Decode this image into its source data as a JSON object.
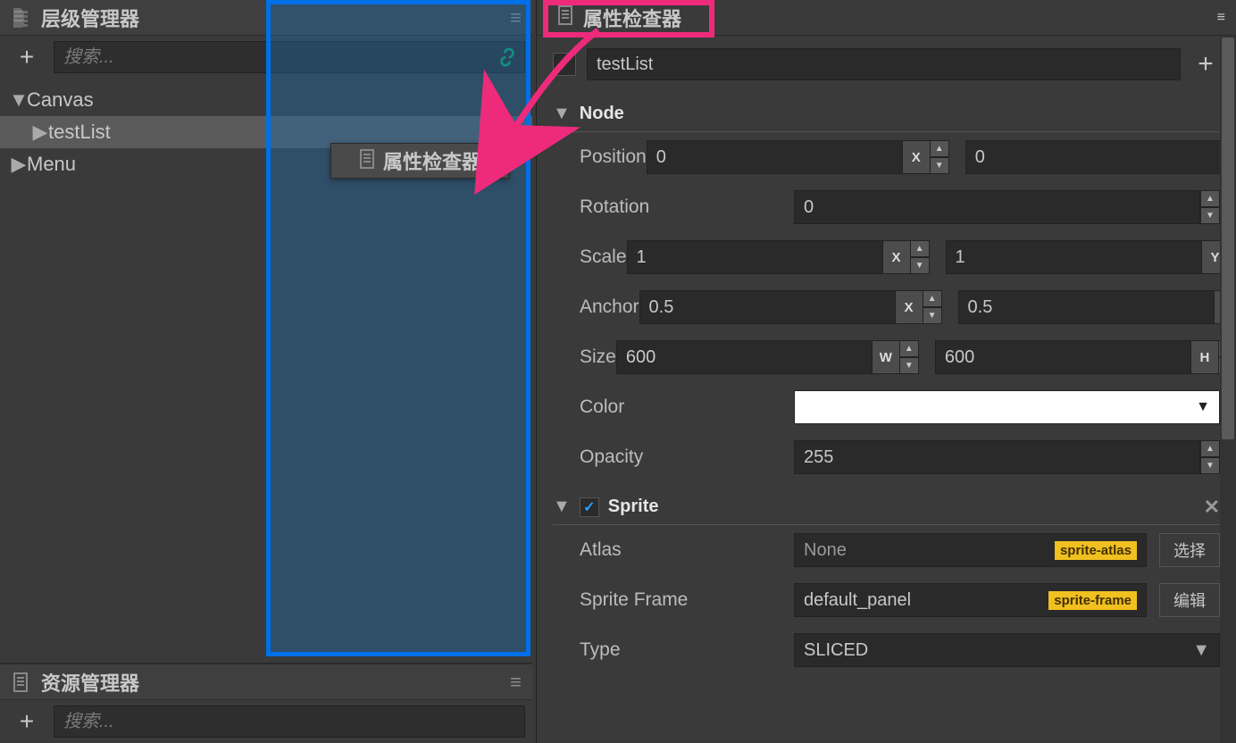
{
  "hierarchy": {
    "title": "层级管理器",
    "search_placeholder": "搜索...",
    "items": [
      {
        "label": "Canvas",
        "expanded": true,
        "indent": 0
      },
      {
        "label": "testList",
        "expanded": false,
        "indent": 1,
        "selected": true
      },
      {
        "label": "Menu",
        "expanded": false,
        "indent": 0
      }
    ]
  },
  "assets": {
    "title": "资源管理器",
    "search_placeholder": "搜索..."
  },
  "inspector": {
    "title": "属性检查器",
    "node_name": "testList",
    "enabled": true,
    "sections": {
      "node": {
        "label": "Node",
        "position": {
          "label": "Position",
          "x": "0",
          "y": "0"
        },
        "rotation": {
          "label": "Rotation",
          "value": "0"
        },
        "scale": {
          "label": "Scale",
          "x": "1",
          "y": "1"
        },
        "anchor": {
          "label": "Anchor",
          "x": "0.5",
          "y": "0.5"
        },
        "size": {
          "label": "Size",
          "w": "600",
          "h": "600"
        },
        "color": {
          "label": "Color",
          "value": "#ffffff"
        },
        "opacity": {
          "label": "Opacity",
          "value": "255"
        }
      },
      "sprite": {
        "label": "Sprite",
        "enabled": true,
        "atlas": {
          "label": "Atlas",
          "value": "None",
          "tag": "sprite-atlas",
          "btn": "选择"
        },
        "sprite_frame": {
          "label": "Sprite Frame",
          "value": "default_panel",
          "tag": "sprite-frame",
          "btn": "编辑"
        },
        "type": {
          "label": "Type",
          "value": "SLICED"
        }
      }
    }
  },
  "drag_ghost": {
    "label": "属性检查器"
  },
  "axis": {
    "x": "X",
    "y": "Y",
    "w": "W",
    "h": "H"
  }
}
